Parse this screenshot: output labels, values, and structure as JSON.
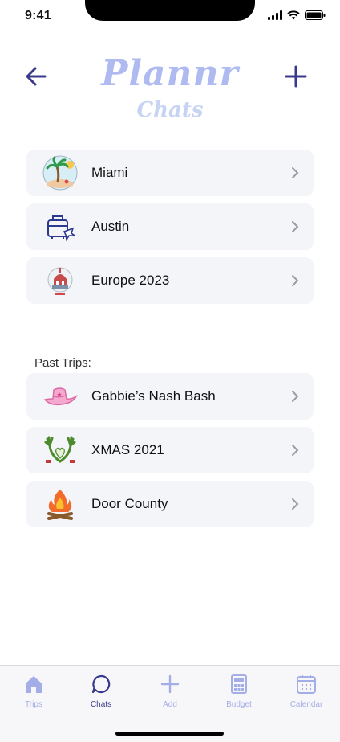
{
  "status_bar": {
    "time": "9:41"
  },
  "header": {
    "brand": "Plannr",
    "subtitle": "Chats"
  },
  "current_trips": [
    {
      "label": "Miami",
      "icon": "palm-tree-icon"
    },
    {
      "label": "Austin",
      "icon": "luggage-icon"
    },
    {
      "label": "Europe 2023",
      "icon": "europe-landmark-icon"
    }
  ],
  "past_trips_heading": "Past Trips:",
  "past_trips": [
    {
      "label": "Gabbie’s Nash Bash",
      "icon": "cowboy-hat-icon"
    },
    {
      "label": "XMAS 2021",
      "icon": "grinch-hands-icon"
    },
    {
      "label": "Door County",
      "icon": "campfire-icon"
    }
  ],
  "tabs": [
    {
      "label": "Trips",
      "icon": "home-icon",
      "active": false
    },
    {
      "label": "Chats",
      "icon": "chat-icon",
      "active": true
    },
    {
      "label": "Add",
      "icon": "plus-icon",
      "active": false
    },
    {
      "label": "Budget",
      "icon": "calculator-icon",
      "active": false
    },
    {
      "label": "Calendar",
      "icon": "calendar-icon",
      "active": false
    }
  ],
  "colors": {
    "accent": "#3a3a8c",
    "brand": "#aebaf0",
    "tab_inactive": "#a4aee6",
    "row_bg": "#f4f5f9"
  }
}
